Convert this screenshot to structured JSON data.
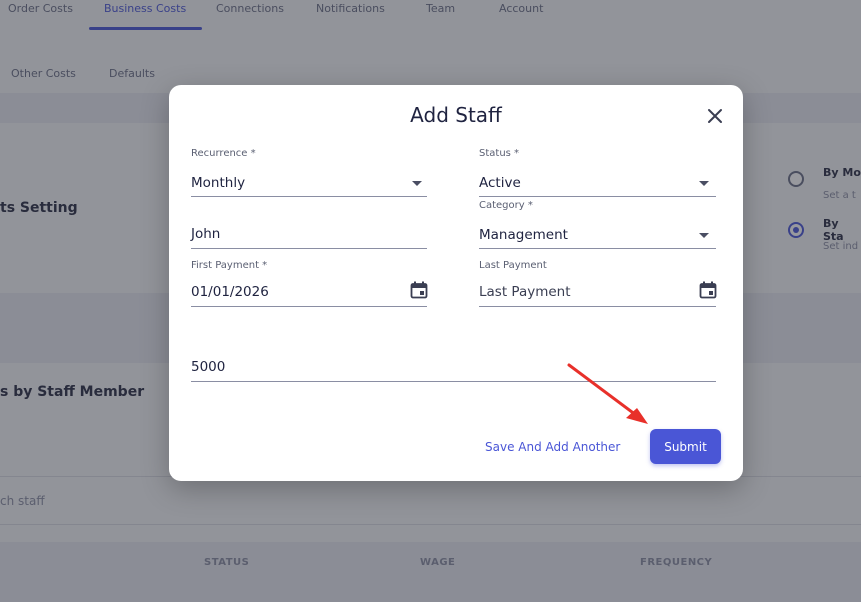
{
  "nav": {
    "tabs": [
      {
        "label": "Order Costs"
      },
      {
        "label": "Business Costs"
      },
      {
        "label": "Connections"
      },
      {
        "label": "Notifications"
      },
      {
        "label": "Team"
      },
      {
        "label": "Account"
      }
    ],
    "active_tab": "Business Costs"
  },
  "subnav": {
    "tabs": [
      {
        "label": "Other Costs"
      },
      {
        "label": "Defaults"
      }
    ]
  },
  "background": {
    "section_setting_title": "ts Setting",
    "section_staff_title": "s by Staff Member",
    "search_placeholder": "ch staff",
    "options": [
      {
        "title": "By Mo",
        "desc": "Set a t",
        "selected": false
      },
      {
        "title": "By Sta",
        "desc": "Set ind",
        "selected": true
      }
    ],
    "table_headers": [
      "STATUS",
      "WAGE",
      "FREQUENCY"
    ]
  },
  "modal": {
    "title": "Add Staff",
    "fields": {
      "recurrence": {
        "label": "Recurrence *",
        "value": "Monthly"
      },
      "status": {
        "label": "Status *",
        "value": "Active"
      },
      "name": {
        "value": "John"
      },
      "category": {
        "label": "Category *",
        "value": "Management"
      },
      "first_payment": {
        "label": "First Payment *",
        "value": "01/01/2026"
      },
      "last_payment": {
        "label": "Last Payment",
        "placeholder": "Last Payment"
      },
      "amount": {
        "value": "5000"
      }
    },
    "save_another_label": "Save And Add Another",
    "submit_label": "Submit"
  },
  "colors": {
    "accent": "#4a56d6",
    "arrow": "#e8302a"
  }
}
